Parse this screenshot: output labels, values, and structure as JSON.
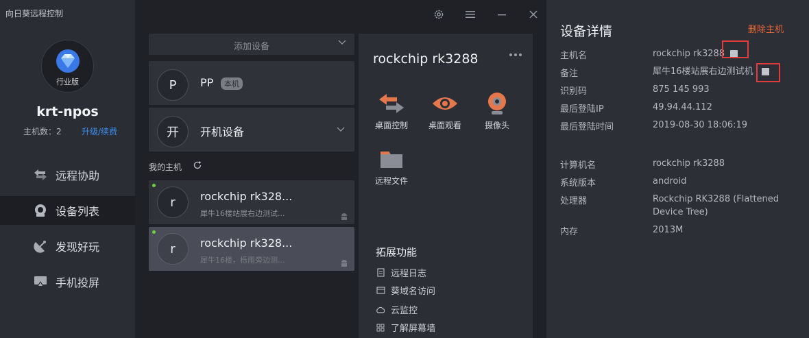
{
  "sidebar": {
    "app_title": "向日葵远程控制",
    "edition": "行业版",
    "username": "krt-npos",
    "host_count": "主机数：2",
    "upgrade": "升级/续费",
    "nav": [
      {
        "label": "远程协助",
        "icon": "remote-assist-icon"
      },
      {
        "label": "设备列表",
        "icon": "device-list-icon",
        "active": true
      },
      {
        "label": "发现好玩",
        "icon": "discover-icon"
      },
      {
        "label": "手机投屏",
        "icon": "cast-screen-icon"
      }
    ]
  },
  "device_list": {
    "add_device": "添加设备",
    "groups": [
      {
        "avatar": "P",
        "name": "PP",
        "badge": "本机"
      },
      {
        "avatar": "开",
        "name": "开机设备"
      }
    ],
    "my_hosts_label": "我的主机",
    "hosts": [
      {
        "avatar": "r",
        "name": "rockchip rk328...",
        "note": "犀牛16楼站展右边测试...",
        "online": true
      },
      {
        "avatar": "r",
        "name": "rockchip rk328...",
        "note": "犀牛16楼，栎雨旁边测...",
        "online": true,
        "selected": true
      }
    ]
  },
  "device_card": {
    "title": "rockchip rk3288",
    "actions": [
      "桌面控制",
      "桌面观看",
      "摄像头",
      "远程文件"
    ],
    "ext_title": "拓展功能",
    "ext_items": [
      "远程日志",
      "葵域名访问",
      "云监控",
      "了解屏幕墙"
    ]
  },
  "details": {
    "title": "设备详情",
    "delete": "删除主机",
    "rows": [
      {
        "label": "主机名",
        "value": "rockchip rk3288"
      },
      {
        "label": "备注",
        "value": "犀牛16楼站展右边测试机"
      },
      {
        "label": "识别码",
        "value": "875 145 993"
      },
      {
        "label": "最后登陆IP",
        "value": "49.94.44.112"
      },
      {
        "label": "最后登陆时间",
        "value": "2019-08-30 18:06:19"
      },
      {
        "label": "计算机名",
        "value": "rockchip rk3288"
      },
      {
        "label": "系统版本",
        "value": "android"
      },
      {
        "label": "处理器",
        "value": "Rockchip RK3288 (Flattened Device Tree)"
      },
      {
        "label": "内存",
        "value": "2013M"
      }
    ]
  },
  "colors": {
    "accent_blue": "#3d8ff0",
    "danger_orange": "#e4683a",
    "online_green": "#6ed13a",
    "highlight_red": "#e23c3c"
  }
}
